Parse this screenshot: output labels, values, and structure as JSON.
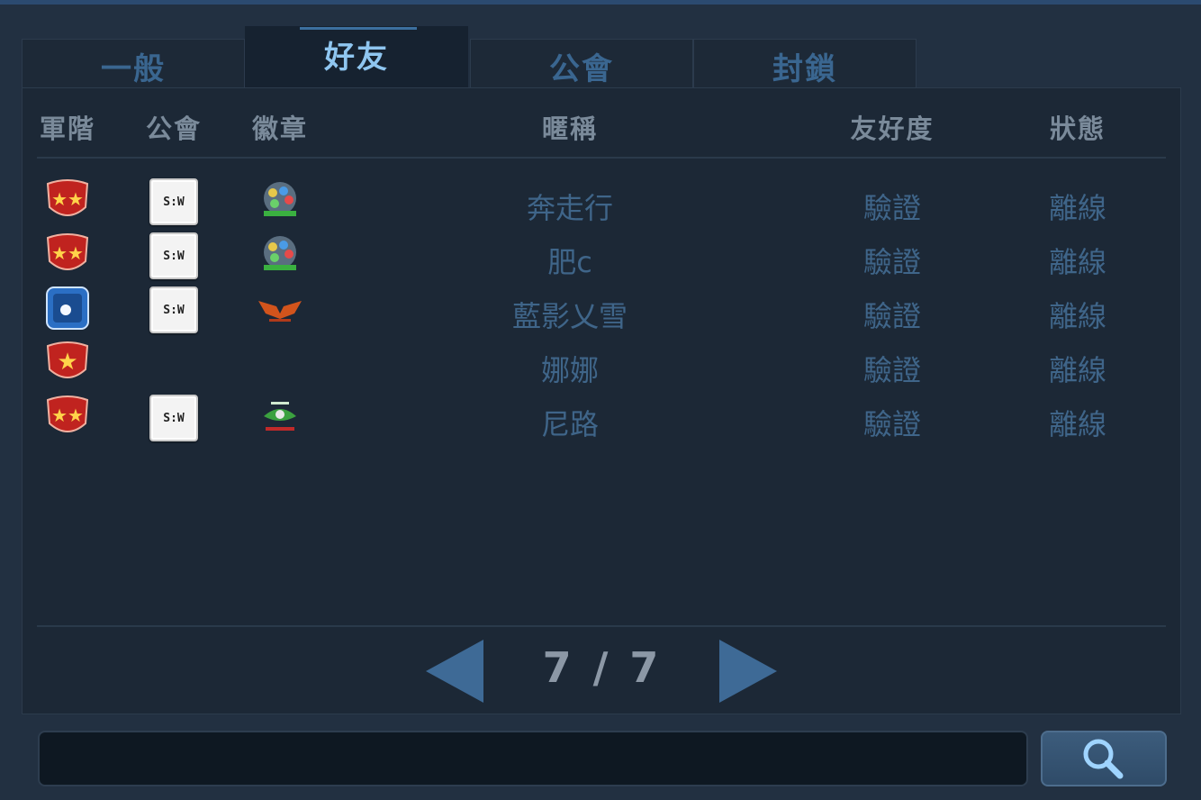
{
  "tabs": [
    {
      "label": "一般",
      "active": false
    },
    {
      "label": "好友",
      "active": true
    },
    {
      "label": "公會",
      "active": false
    },
    {
      "label": "封鎖",
      "active": false
    }
  ],
  "columns": {
    "rank": "軍階",
    "guild": "公會",
    "badge": "徽章",
    "nickname": "暱稱",
    "friendship": "友好度",
    "status": "狀態"
  },
  "friends": [
    {
      "rank_icon": "red-two-star-rank-icon",
      "guild_icon": "guild-emblem-icon",
      "guild_text": "S:W",
      "badge_icon": "colorful-crest-badge-icon",
      "nickname": "奔走行",
      "friendship": "驗證",
      "status": "離線"
    },
    {
      "rank_icon": "red-two-star-rank-icon",
      "guild_icon": "guild-emblem-icon",
      "guild_text": "S:W",
      "badge_icon": "colorful-crest-badge-icon",
      "nickname": "肥c",
      "friendship": "驗證",
      "status": "離線"
    },
    {
      "rank_icon": "blue-rank-icon",
      "guild_icon": "guild-emblem-icon",
      "guild_text": "S:W",
      "badge_icon": "orange-wings-badge-icon",
      "nickname": "藍影乂雪",
      "friendship": "驗證",
      "status": "離線"
    },
    {
      "rank_icon": "red-one-star-rank-icon",
      "guild_icon": "",
      "guild_text": "",
      "badge_icon": "",
      "nickname": "娜娜",
      "friendship": "驗證",
      "status": "離線"
    },
    {
      "rank_icon": "red-two-star-rank-icon",
      "guild_icon": "guild-emblem-icon",
      "guild_text": "S:W",
      "badge_icon": "green-eagle-badge-icon",
      "nickname": "尼路",
      "friendship": "驗證",
      "status": "離線"
    }
  ],
  "pager": {
    "text": "7 / 7",
    "prev_icon": "left-arrow-icon",
    "next_icon": "right-arrow-icon"
  },
  "search": {
    "value": "",
    "placeholder": "",
    "button_icon": "magnifier-icon"
  },
  "colors": {
    "accent": "#8fc6f0",
    "text_dim": "#3f6589",
    "header": "#7a8a9a",
    "arrow": "#3e6a96"
  }
}
